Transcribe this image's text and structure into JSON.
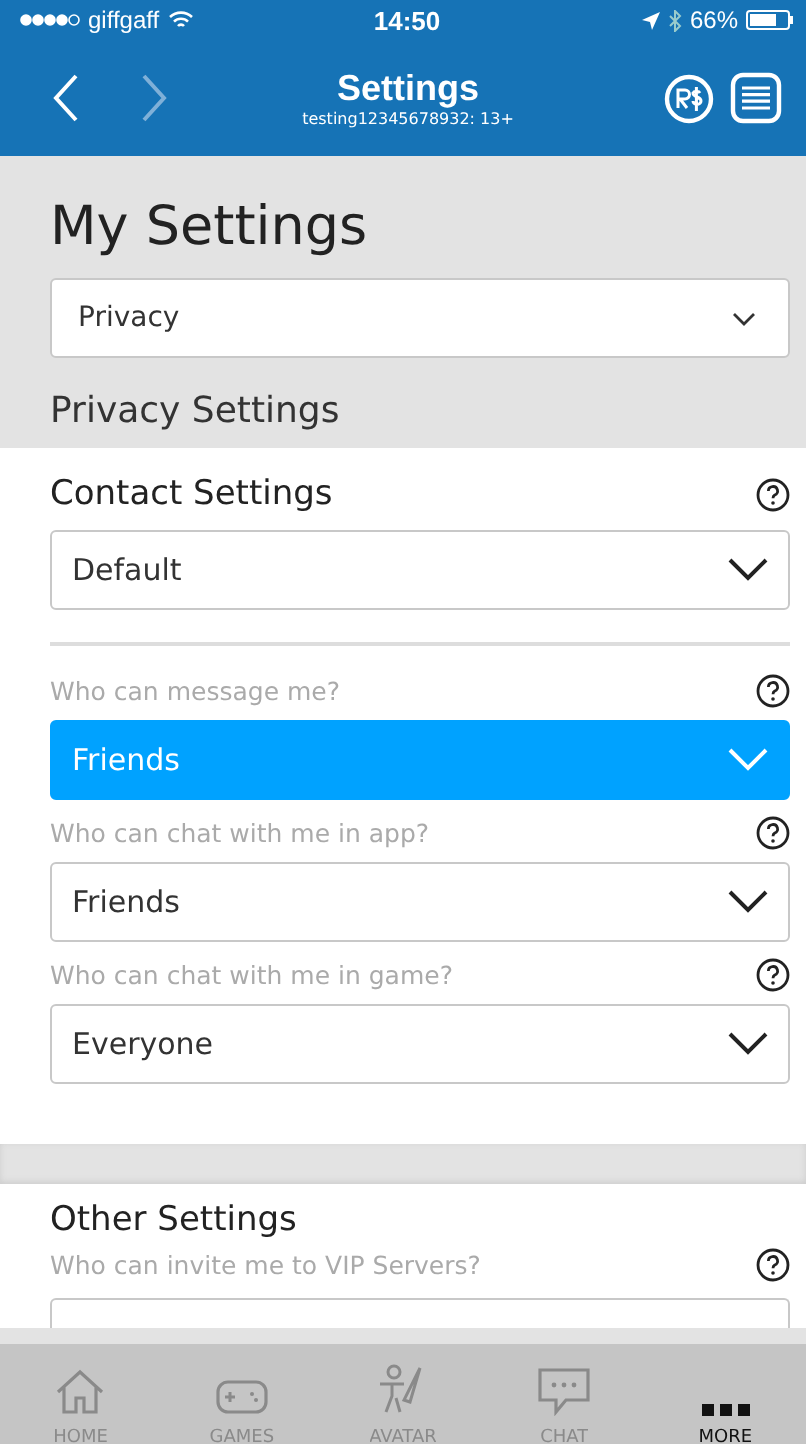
{
  "status_bar": {
    "carrier": "giffgaff",
    "time": "14:50",
    "battery": "66%"
  },
  "header": {
    "title": "Settings",
    "subtitle": "testing12345678932: 13+"
  },
  "page_title": "My Settings",
  "category_select": {
    "value": "Privacy"
  },
  "section_title": "Privacy Settings",
  "contact_settings": {
    "title": "Contact Settings",
    "value": "Default",
    "questions": [
      {
        "label": "Who can message me?",
        "value": "Friends",
        "selected": true
      },
      {
        "label": "Who can chat with me in app?",
        "value": "Friends",
        "selected": false
      },
      {
        "label": "Who can chat with me in game?",
        "value": "Everyone",
        "selected": false
      }
    ]
  },
  "other_settings": {
    "title": "Other Settings",
    "questions": [
      {
        "label": "Who can invite me to VIP Servers?"
      }
    ]
  },
  "tab_bar": [
    {
      "label": "HOME",
      "kind": "home",
      "selected": false
    },
    {
      "label": "GAMES",
      "kind": "games",
      "selected": false
    },
    {
      "label": "AVATAR",
      "kind": "avatar",
      "selected": false
    },
    {
      "label": "CHAT",
      "kind": "chat",
      "selected": false
    },
    {
      "label": "MORE",
      "kind": "more",
      "selected": true
    }
  ]
}
